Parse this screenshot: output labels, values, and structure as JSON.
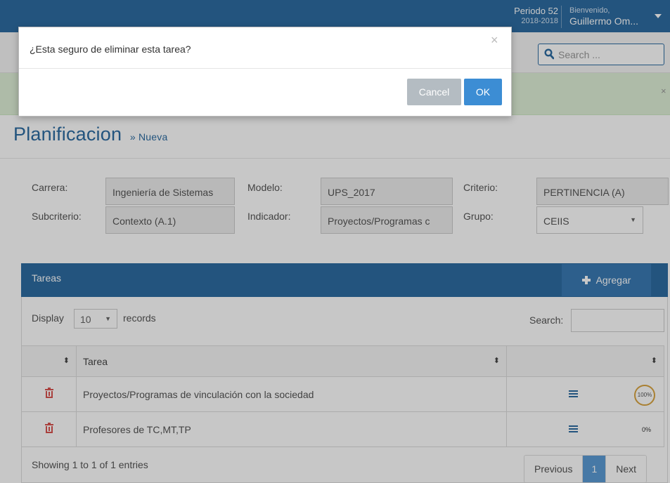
{
  "header": {
    "periodo_label": "Periodo 52",
    "periodo_range": "2018-2018",
    "welcome_label": "Bienvenido,",
    "user_name": "Guillermo Om..."
  },
  "search": {
    "placeholder": "Search ..."
  },
  "alert": {
    "close": "×"
  },
  "page": {
    "title": "Planificacion",
    "breadcrumb": "» Nueva"
  },
  "form": {
    "carrera_label": "Carrera:",
    "carrera_value": "Ingeniería de Sistemas",
    "modelo_label": "Modelo:",
    "modelo_value": "UPS_2017",
    "criterio_label": "Criterio:",
    "criterio_value": "PERTINENCIA (A)",
    "subcriterio_label": "Subcriterio:",
    "subcriterio_value": "Contexto (A.1)",
    "indicador_label": "Indicador:",
    "indicador_value": "Proyectos/Programas c",
    "grupo_label": "Grupo:",
    "grupo_value": "CEIIS"
  },
  "panel": {
    "title": "Tareas",
    "add_label": "Agregar"
  },
  "table_controls": {
    "display_label": "Display",
    "display_value": "10",
    "records_label": "records",
    "search_label": "Search:"
  },
  "table": {
    "column_tarea": "Tarea",
    "sort_glyph": "⬍",
    "rows": [
      {
        "tarea": "Proyectos/Programas de vinculación con la sociedad",
        "progress": "100%",
        "progress_value": 100
      },
      {
        "tarea": "Profesores de TC,MT,TP",
        "progress": "0%",
        "progress_value": 0
      }
    ]
  },
  "footer": {
    "showing": "Showing 1 to 1 of 1 entries",
    "previous": "Previous",
    "page": "1",
    "next": "Next"
  },
  "modal": {
    "message": "¿Esta seguro de eliminar esta tarea?",
    "close": "×",
    "cancel": "Cancel",
    "ok": "OK"
  },
  "colors": {
    "primary": "#2d6ca2",
    "danger": "#d9534f",
    "success_bg": "#dff0d8",
    "ok_button": "#3c8dd4",
    "cancel_button": "#b4bcc2",
    "progress_ring": "#d9a441"
  },
  "icons": [
    "search-icon",
    "caret-down-icon",
    "plus-icon",
    "trash-icon",
    "menu-icon",
    "sort-icon",
    "close-icon"
  ]
}
